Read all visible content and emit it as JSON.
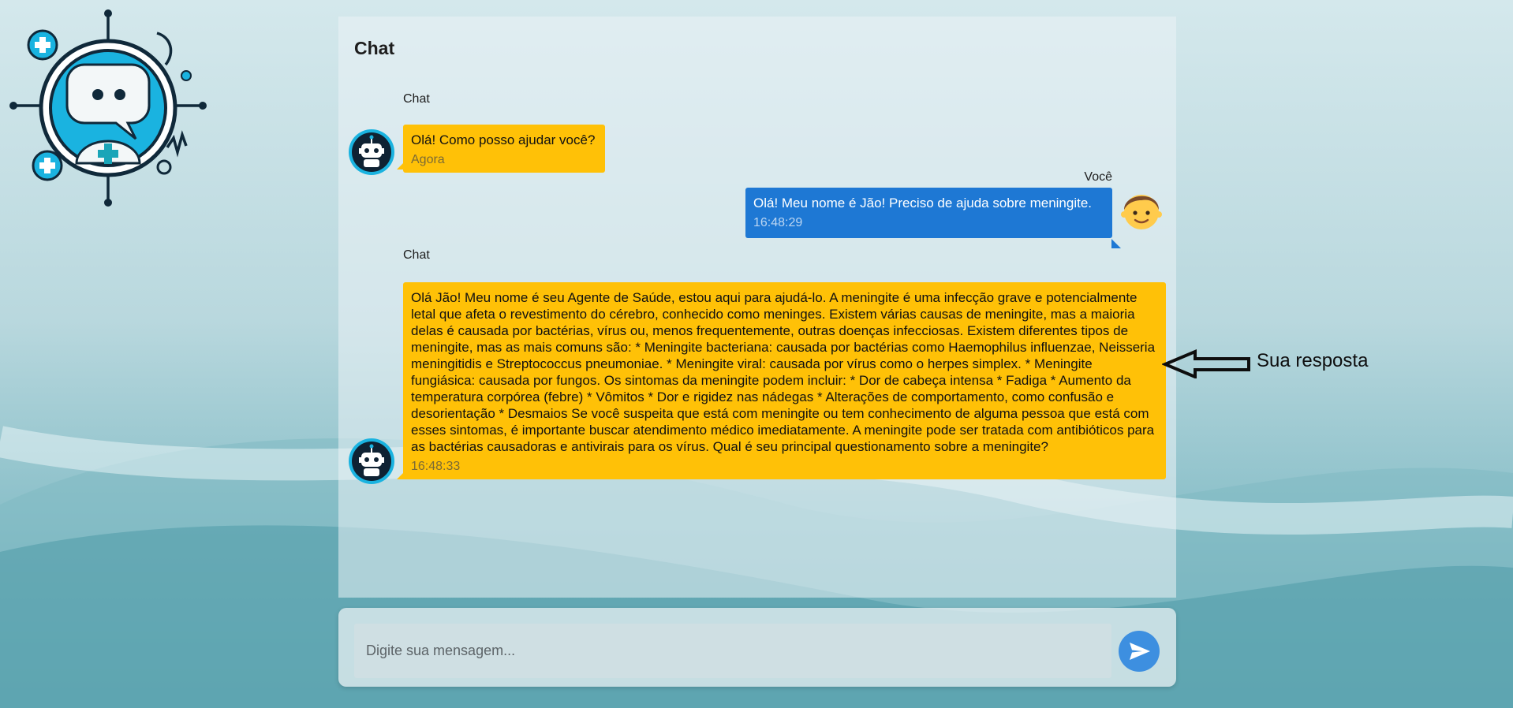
{
  "chat": {
    "title": "Chat",
    "messages": [
      {
        "sender": "Chat",
        "role": "bot",
        "text": "Olá! Como posso ajudar você?",
        "time": "Agora"
      },
      {
        "sender": "Você",
        "role": "user",
        "text": "Olá! Meu nome é Jão! Preciso de ajuda sobre meningite.",
        "time": "16:48:29"
      },
      {
        "sender": "Chat",
        "role": "bot",
        "text": "Olá Jão! Meu nome é seu Agente de Saúde, estou aqui para ajudá-lo. A meningite é uma infecção grave e potencialmente letal que afeta o revestimento do cérebro, conhecido como meninges. Existem várias causas de meningite, mas a maioria delas é causada por bactérias, vírus ou, menos frequentemente, outras doenças infecciosas. Existem diferentes tipos de meningite, mas as mais comuns são: * Meningite bacteriana: causada por bactérias como Haemophilus influenzae, Neisseria meningitidis e Streptococcus pneumoniae. * Meningite viral: causada por vírus como o herpes simplex. * Meningite fungiásica: causada por fungos. Os sintomas da meningite podem incluir: * Dor de cabeça intensa * Fadiga * Aumento da temperatura corpórea (febre) * Vômitos * Dor e rigidez nas nádegas * Alterações de comportamento, como confusão e desorientação * Desmaios Se você suspeita que está com meningite ou tem conhecimento de alguma pessoa que está com esses sintomas, é importante buscar atendimento médico imediatamente. A meningite pode ser tratada com antibióticos para as bactérias causadoras e antivirais para os vírus. Qual é seu principal questionamento sobre a meningite?",
        "time": "16:48:33"
      }
    ]
  },
  "input": {
    "placeholder": "Digite sua mensagem...",
    "value": ""
  },
  "annotation": {
    "label": "Sua resposta"
  },
  "colors": {
    "bot_bubble": "#ffc107",
    "user_bubble": "#1e78d4",
    "send_button": "#3d8fe0",
    "logo_accent": "#1ab3e0"
  },
  "icons": {
    "logo": "medical-chatbot-logo",
    "bot_avatar": "robot-icon",
    "user_avatar": "boy-emoji-icon",
    "send": "send-arrow-icon",
    "annotation_arrow": "left-arrow-icon"
  }
}
